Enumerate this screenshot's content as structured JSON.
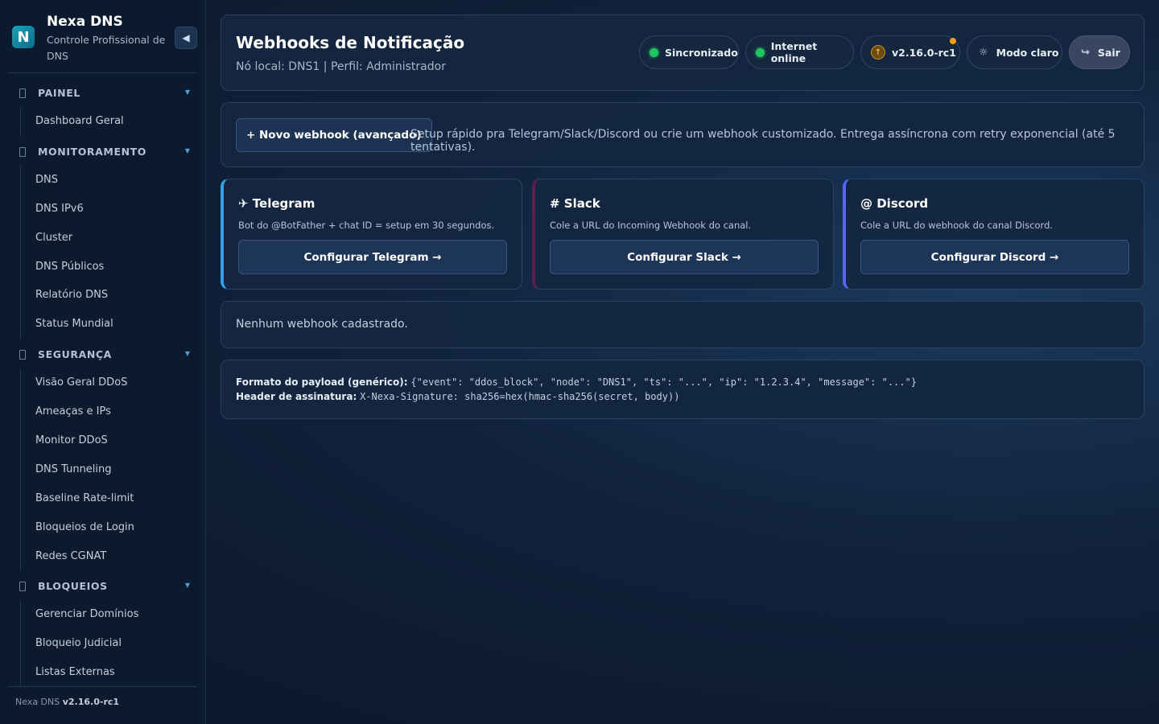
{
  "sidebar": {
    "brand_name": "Nexa DNS",
    "brand_sub": "Controle Profissional de DNS",
    "logo_letter": "N",
    "collapse_icon": "◀",
    "sections": [
      {
        "title": "PAINEL",
        "items": [
          "Dashboard Geral"
        ]
      },
      {
        "title": "MONITORAMENTO",
        "items": [
          "DNS",
          "DNS IPv6",
          "Cluster",
          "DNS Públicos",
          "Relatório DNS",
          "Status Mundial"
        ]
      },
      {
        "title": "SEGURANÇA",
        "items": [
          "Visão Geral DDoS",
          "Ameaças e IPs",
          "Monitor DDoS",
          "DNS Tunneling",
          "Baseline Rate-limit",
          "Bloqueios de Login",
          "Redes CGNAT"
        ]
      },
      {
        "title": "BLOQUEIOS",
        "items": [
          "Gerenciar Domínios",
          "Bloqueio Judicial",
          "Listas Externas"
        ]
      }
    ],
    "footer_prefix": "Nexa DNS",
    "footer_version": "v2.16.0-rc1"
  },
  "header": {
    "title": "Webhooks de Notificação",
    "subtitle": "Nó local: DNS1 | Perfil: Administrador",
    "status_sync": "Sincronizado",
    "status_internet": "Internet online",
    "version": "v2.16.0-rc1",
    "theme_label": "Modo claro",
    "logout_label": "Sair"
  },
  "intro": {
    "new_button": "+ Novo webhook (avançado)",
    "text": "Setup rápido pra Telegram/Slack/Discord ou crie um webhook customizado. Entrega assíncrona com retry exponencial (até 5 tentativas)."
  },
  "services": {
    "telegram": {
      "title": "✈ Telegram",
      "desc": "Bot do @BotFather + chat ID = setup em 30 segundos.",
      "button": "Configurar Telegram →"
    },
    "slack": {
      "title": "# Slack",
      "desc": "Cole a URL do Incoming Webhook do canal.",
      "button": "Configurar Slack →"
    },
    "discord": {
      "title": "@ Discord",
      "desc": "Cole a URL do webhook do canal Discord.",
      "button": "Configurar Discord →"
    }
  },
  "empty_text": "Nenhum webhook cadastrado.",
  "payload": {
    "format_label": "Formato do payload (genérico):",
    "format_value": "{\"event\": \"ddos_block\", \"node\": \"DNS1\", \"ts\": \"...\", \"ip\": \"1.2.3.4\", \"message\": \"...\"}",
    "header_label": "Header de assinatura:",
    "header_value": "X-Nexa-Signature: sha256=hex(hmac-sha256(secret, body))"
  },
  "colors": {
    "telegram_accent": "#2fa3e6",
    "slack_accent": "#5a1f4b",
    "discord_accent": "#5865f2",
    "online_dot": "#22c55e",
    "update_badge": "#f59e0b"
  }
}
